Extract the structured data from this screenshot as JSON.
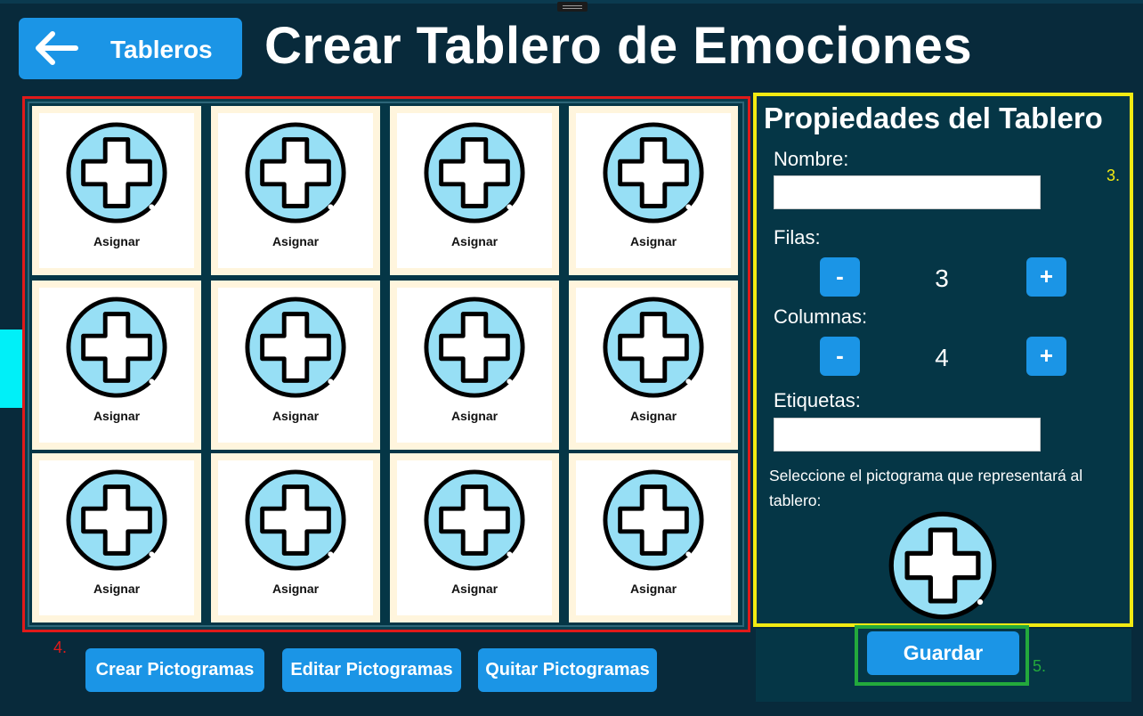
{
  "header": {
    "back_label": "Tableros",
    "title": "Crear Tablero de Emociones"
  },
  "grid": {
    "rows": 3,
    "columns": 4,
    "cell_label": "Asignar",
    "icon": "add-circle-icon"
  },
  "properties": {
    "title": "Propiedades del Tablero",
    "name_label": "Nombre:",
    "name_value": "",
    "rows_label": "Filas:",
    "rows_value": "3",
    "columns_label": "Columnas:",
    "columns_value": "4",
    "minus_label": "-",
    "plus_label": "+",
    "tags_label": "Etiquetas:",
    "tags_value": "",
    "pictogram_note": "Seleccione el pictograma que representará al tablero:"
  },
  "actions": {
    "save_label": "Guardar",
    "create_label": "Crear Pictogramas",
    "edit_label": "Editar Pictogramas",
    "remove_label": "Quitar Pictogramas"
  },
  "annotations": {
    "a3": "3.",
    "a4": "4.",
    "a5": "5."
  },
  "colors": {
    "background": "#082a3b",
    "button": "#1b95e6",
    "grid_border": "#e01a1a",
    "props_border": "#f3ea12",
    "save_border": "#23a93c",
    "icon_fill": "#97dff5"
  }
}
